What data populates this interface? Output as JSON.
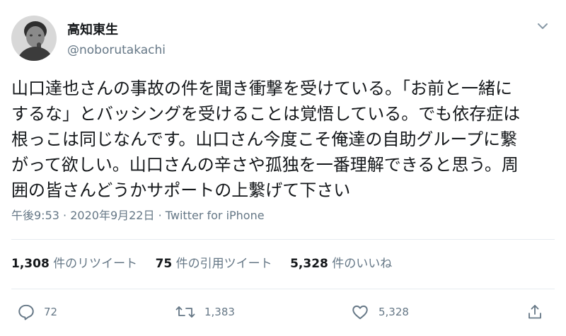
{
  "author": {
    "display_name": "高知東生",
    "handle": "@noborutakachi"
  },
  "tweet": {
    "lines": [
      "山口達也さんの事故の件を聞き衝撃を受けている。「お前と一緒に",
      "するな」とバッシングを受けることは覚悟している。でも依存症は",
      "根っこは同じなんです。山口さん今度こそ俺達の自助グループに繋",
      "がって欲しい。山口さんの辛さや孤独を一番理解できると思う。周",
      "囲の皆さんどうかサポートの上繫げて下さい"
    ],
    "time": "午後9:53",
    "date": "2020年9月22日",
    "separator": "·",
    "source": "Twitter for iPhone"
  },
  "stats": {
    "retweets_count": "1,308",
    "retweets_label": "件のリツイート",
    "quotes_count": "75",
    "quotes_label": "件の引用ツイート",
    "likes_count": "5,328",
    "likes_label": "件のいいね"
  },
  "actions": {
    "reply_count": "72",
    "retweet_count": "1,383",
    "like_count": "5,328"
  },
  "colors": {
    "text": "#14171a",
    "secondary": "#657786",
    "divider": "#e6ecf0"
  },
  "icons": [
    "avatar",
    "chevron-down-icon",
    "reply-icon",
    "retweet-icon",
    "like-icon",
    "share-icon"
  ]
}
